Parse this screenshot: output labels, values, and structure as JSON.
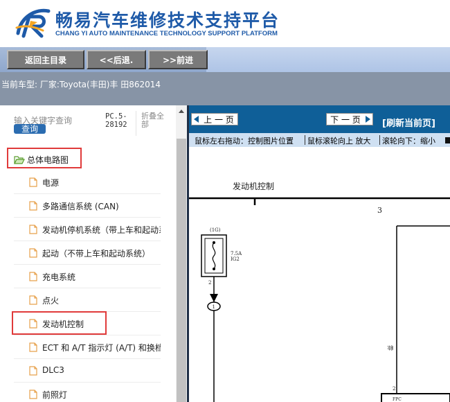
{
  "header": {
    "title_cn": "畅易汽车维修技术支持平台",
    "title_en": "CHANG YI AUTO MAINTENANCE TECHNOLOGY SUPPORT PLATFORM",
    "logo_icon": "stylized-r-logo-icon",
    "colors": {
      "brand_blue": "#1e5aa8",
      "logo_orange": "#f5a623"
    }
  },
  "toolbar": {
    "back_main": "返回主目录",
    "back": "<<后退.",
    "forward": ">>前进"
  },
  "vehicle": {
    "line": "当前车型:   厂家:Toyota(丰田)丰 田862014"
  },
  "search": {
    "label": "输入关键字查询",
    "button": "查询",
    "pc_code": "PC.5-28192",
    "collapse": "折叠全部"
  },
  "tree": {
    "root": "总体电路图",
    "items": [
      {
        "label": "电源"
      },
      {
        "label": "多路通信系统 (CAN)"
      },
      {
        "label": "发动机停机系统（带上车和起动系统）"
      },
      {
        "label": "起动（不带上车和起动系统）"
      },
      {
        "label": "充电系统"
      },
      {
        "label": "点火"
      },
      {
        "label": "发动机控制"
      },
      {
        "label": "ECT 和 A/T 指示灯 (A/T) 和换档锁止"
      },
      {
        "label": "DLC3"
      },
      {
        "label": "前照灯"
      }
    ],
    "highlight_color": "#e03a3a"
  },
  "viewer": {
    "prev": "上 一 页",
    "next": "下 一 页",
    "refresh": "[刷新当前页]",
    "hint_1": "鼠标左右拖动：控制图片位置",
    "hint_2": "鼠标滚轮向上 放大",
    "hint_3": "滚轮向下：缩小",
    "nav_color": "#0f5f98"
  },
  "diagram": {
    "title": "发动机控制",
    "col_num": "3",
    "fuse_name": "(1G)",
    "fuse_rating": "7.5A",
    "fuse_code": "IG2",
    "pin_top": "2",
    "connector": "1",
    "side_label": "雰",
    "pin_bottom": "2",
    "ecu_label": "FPC"
  }
}
